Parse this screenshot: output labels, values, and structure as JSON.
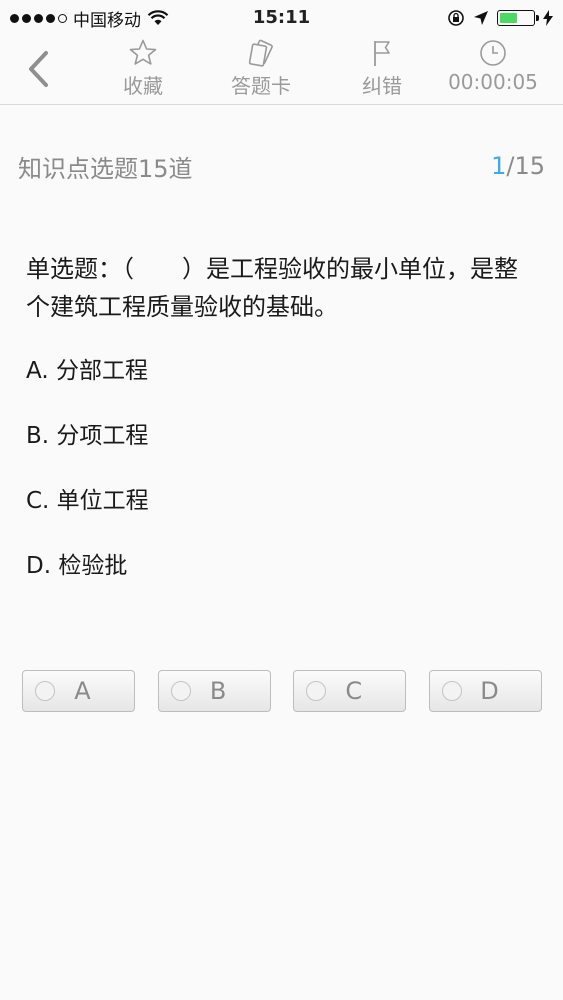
{
  "status_bar": {
    "carrier": "中国移动",
    "time": "15:11",
    "battery_color": "#4cd964",
    "battery_level": 0.55
  },
  "toolbar": {
    "back_icon": "chevron-left-icon",
    "items": [
      {
        "label": "收藏",
        "icon": "star-icon"
      },
      {
        "label": "答题卡",
        "icon": "answer-card-icon"
      },
      {
        "label": "纠错",
        "icon": "flag-icon"
      },
      {
        "label": "00:00:05",
        "icon": "clock-icon"
      }
    ]
  },
  "section": {
    "title": "知识点选题15道",
    "current": "1",
    "total": "/15",
    "accent_color": "#3fa9e8"
  },
  "question": {
    "text": "单选题：（　　）是工程验收的最小单位，是整个建筑工程质量验收的基础。",
    "options": [
      "A. 分部工程",
      "B. 分项工程",
      "C. 单位工程",
      "D. 检验批"
    ]
  },
  "answers": [
    "A",
    "B",
    "C",
    "D"
  ]
}
